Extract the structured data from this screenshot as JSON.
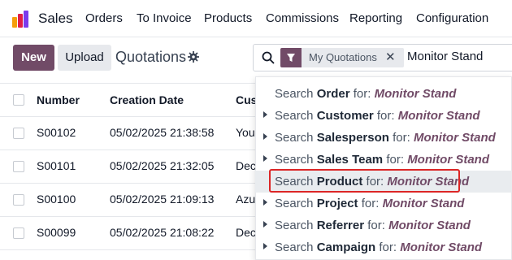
{
  "app": {
    "name": "Sales"
  },
  "menu": [
    "Orders",
    "To Invoice",
    "Products",
    "Commissions",
    "Reporting",
    "Configuration"
  ],
  "toolbar": {
    "new_label": "New",
    "upload_label": "Upload",
    "title": "Quotations"
  },
  "search": {
    "facet_label": "My Quotations",
    "query": "Monitor Stand"
  },
  "table": {
    "columns": [
      "Number",
      "Creation Date",
      "Cus"
    ],
    "rows": [
      {
        "number": "S00102",
        "date": "05/02/2025 21:38:58",
        "customer": "You"
      },
      {
        "number": "S00101",
        "date": "05/02/2025 21:32:05",
        "customer": "Dec"
      },
      {
        "number": "S00100",
        "date": "05/02/2025 21:09:13",
        "customer": "Azu"
      },
      {
        "number": "S00099",
        "date": "05/02/2025 21:08:22",
        "customer": "Dec"
      }
    ]
  },
  "dropdown": {
    "prefix": "Search",
    "connector": "for:",
    "value": "Monitor Stand",
    "items": [
      {
        "field": "Order",
        "expandable": false
      },
      {
        "field": "Customer",
        "expandable": true
      },
      {
        "field": "Salesperson",
        "expandable": true
      },
      {
        "field": "Sales Team",
        "expandable": true
      },
      {
        "field": "Product",
        "expandable": false,
        "active": true
      },
      {
        "field": "Project",
        "expandable": true
      },
      {
        "field": "Referrer",
        "expandable": true
      },
      {
        "field": "Campaign",
        "expandable": true
      }
    ]
  },
  "colors": {
    "brand": "#714b67",
    "highlight": "#dc2626"
  },
  "icons": [
    "sales-logo-icon",
    "gear-icon",
    "search-icon",
    "filter-icon",
    "close-icon",
    "caret-right-icon"
  ]
}
